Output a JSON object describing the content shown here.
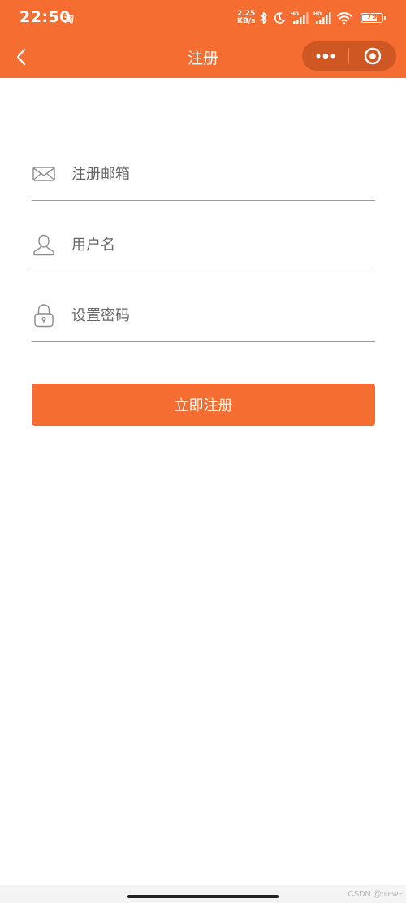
{
  "status_bar": {
    "time": "22:50",
    "app_indicator": "淘",
    "net_speed_value": "2.25",
    "net_speed_unit": "KB/s",
    "battery_level": "79",
    "battery_fraction": 0.79,
    "icons": [
      "bluetooth-icon",
      "moon-icon",
      "hd-signal-icon",
      "hd-signal-icon",
      "wifi-icon",
      "battery-icon"
    ]
  },
  "nav": {
    "title": "注册",
    "back_icon": "chevron-left-icon",
    "more_icon": "more-dots-icon",
    "close_icon": "target-circle-icon"
  },
  "form": {
    "email": {
      "placeholder": "注册邮箱",
      "value": "",
      "icon": "envelope-icon"
    },
    "username": {
      "placeholder": "用户名",
      "value": "",
      "icon": "user-icon"
    },
    "password": {
      "placeholder": "设置密码",
      "value": "",
      "icon": "lock-icon"
    }
  },
  "submit_label": "立即注册",
  "watermark": "CSDN @niew~",
  "colors": {
    "accent": "#f56d30",
    "divider": "#9a9a9a",
    "icon_gray": "#8c8c8c",
    "background": "#ffffff"
  }
}
